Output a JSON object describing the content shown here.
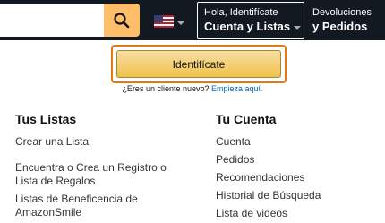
{
  "header": {
    "account_greeting": "Hola, Identifícate",
    "account_main": "Cuenta y Listas",
    "returns_small": "Devoluciones",
    "returns_big": "y Pedidos",
    "search_icon": "search-icon",
    "flag_icon": "us-flag-icon",
    "search_button_color": "#febd69",
    "navbar_color": "#131921"
  },
  "signin": {
    "button_label": "Identifícate",
    "new_customer_text": "¿Eres un cliente nuevo? ",
    "start_here_link": "Empieza aquí."
  },
  "lists": {
    "title": "Tus Listas",
    "items": [
      "Crear una Lista",
      "Encuentra o Crea un Registro o Lista de Regalos",
      "Listas de Beneficencia de AmazonSmile"
    ]
  },
  "account": {
    "title": "Tu Cuenta",
    "items": [
      "Cuenta",
      "Pedidos",
      "Recomendaciones",
      "Historial de Búsqueda",
      "Lista de videos"
    ]
  }
}
